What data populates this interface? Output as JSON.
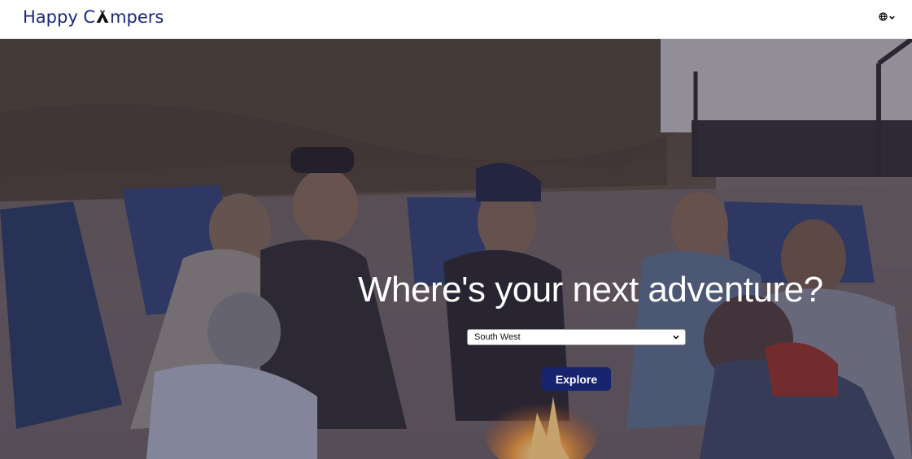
{
  "header": {
    "logo_part1": "Happy C",
    "logo_part2": "mpers",
    "logo_icon": "tent-icon",
    "language_icon": "globe-icon",
    "language_chevron": "chevron-down-icon"
  },
  "hero": {
    "headline": "Where's your next adventure?",
    "region_selected": "South West",
    "explore_label": "Explore",
    "image_subject": "friends-around-campfire-photo"
  },
  "colors": {
    "brand": "#1a2a7c",
    "button": "#17246e",
    "header_bg": "#ffffff"
  }
}
